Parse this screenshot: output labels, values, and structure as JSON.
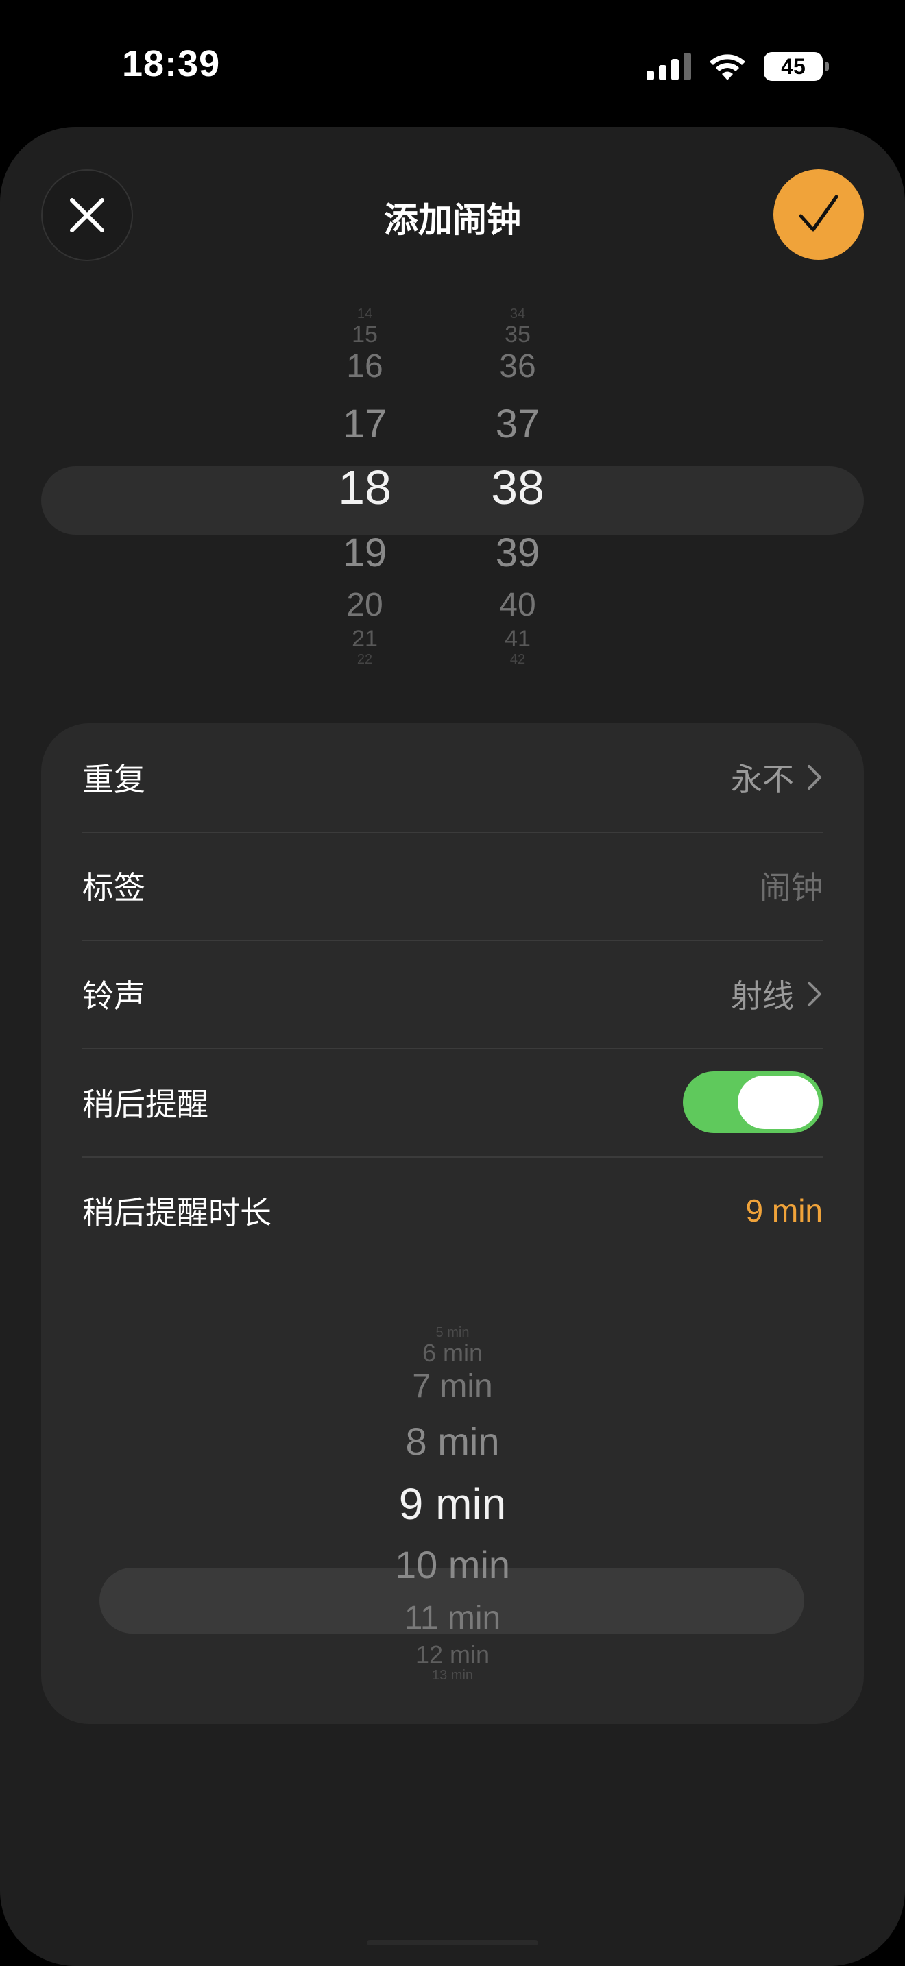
{
  "status": {
    "time": "18:39",
    "battery": "45"
  },
  "sheet": {
    "title": "添加闹钟"
  },
  "time_picker": {
    "hours": [
      "14",
      "15",
      "16",
      "17",
      "18",
      "19",
      "20",
      "21",
      "22"
    ],
    "minutes": [
      "34",
      "35",
      "36",
      "37",
      "38",
      "39",
      "40",
      "41",
      "42"
    ],
    "selected_hour": "18",
    "selected_minute": "38"
  },
  "settings": {
    "repeat": {
      "label": "重复",
      "value": "永不"
    },
    "label": {
      "label": "标签",
      "placeholder": "闹钟"
    },
    "sound": {
      "label": "铃声",
      "value": "射线"
    },
    "snooze": {
      "label": "稍后提醒",
      "on": true
    },
    "snooze_duration": {
      "label": "稍后提醒时长",
      "value": "9 min"
    }
  },
  "snooze_picker": {
    "options": [
      "5 min",
      "6 min",
      "7 min",
      "8 min",
      "9 min",
      "10 min",
      "11 min",
      "12 min",
      "13 min"
    ],
    "selected": "9 min"
  },
  "colors": {
    "accent": "#f0a33a",
    "toggle_on": "#5fc95c",
    "background": "#1f1f1f",
    "card": "#2a2a2a"
  }
}
